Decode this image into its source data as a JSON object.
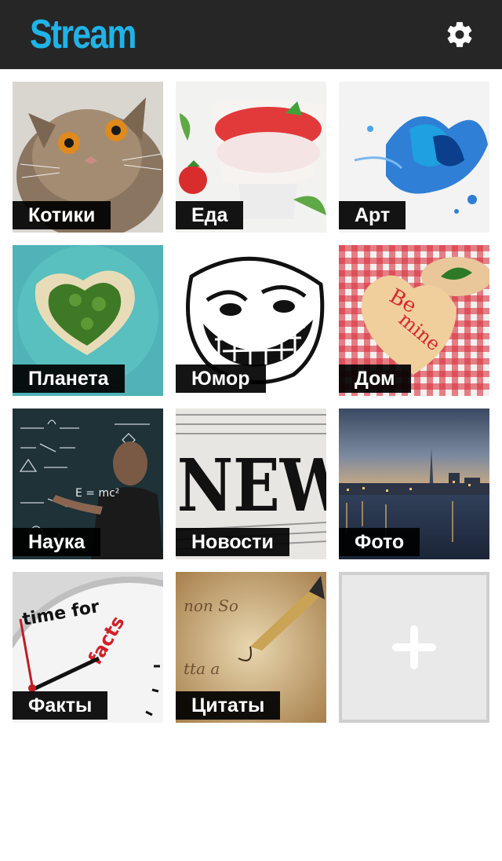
{
  "app_bar": {
    "title": "Stream",
    "settings_icon": "gear-icon",
    "background": "#262626",
    "accent": "#1fb3e8"
  },
  "categories": [
    {
      "label": "Котики"
    },
    {
      "label": "Еда"
    },
    {
      "label": "Арт"
    },
    {
      "label": "Планета"
    },
    {
      "label": "Юмор"
    },
    {
      "label": "Дом"
    },
    {
      "label": "Наука"
    },
    {
      "label": "Новости"
    },
    {
      "label": "Фото"
    },
    {
      "label": "Факты"
    },
    {
      "label": "Цитаты"
    }
  ],
  "add_tile": {
    "icon": "plus-icon"
  }
}
